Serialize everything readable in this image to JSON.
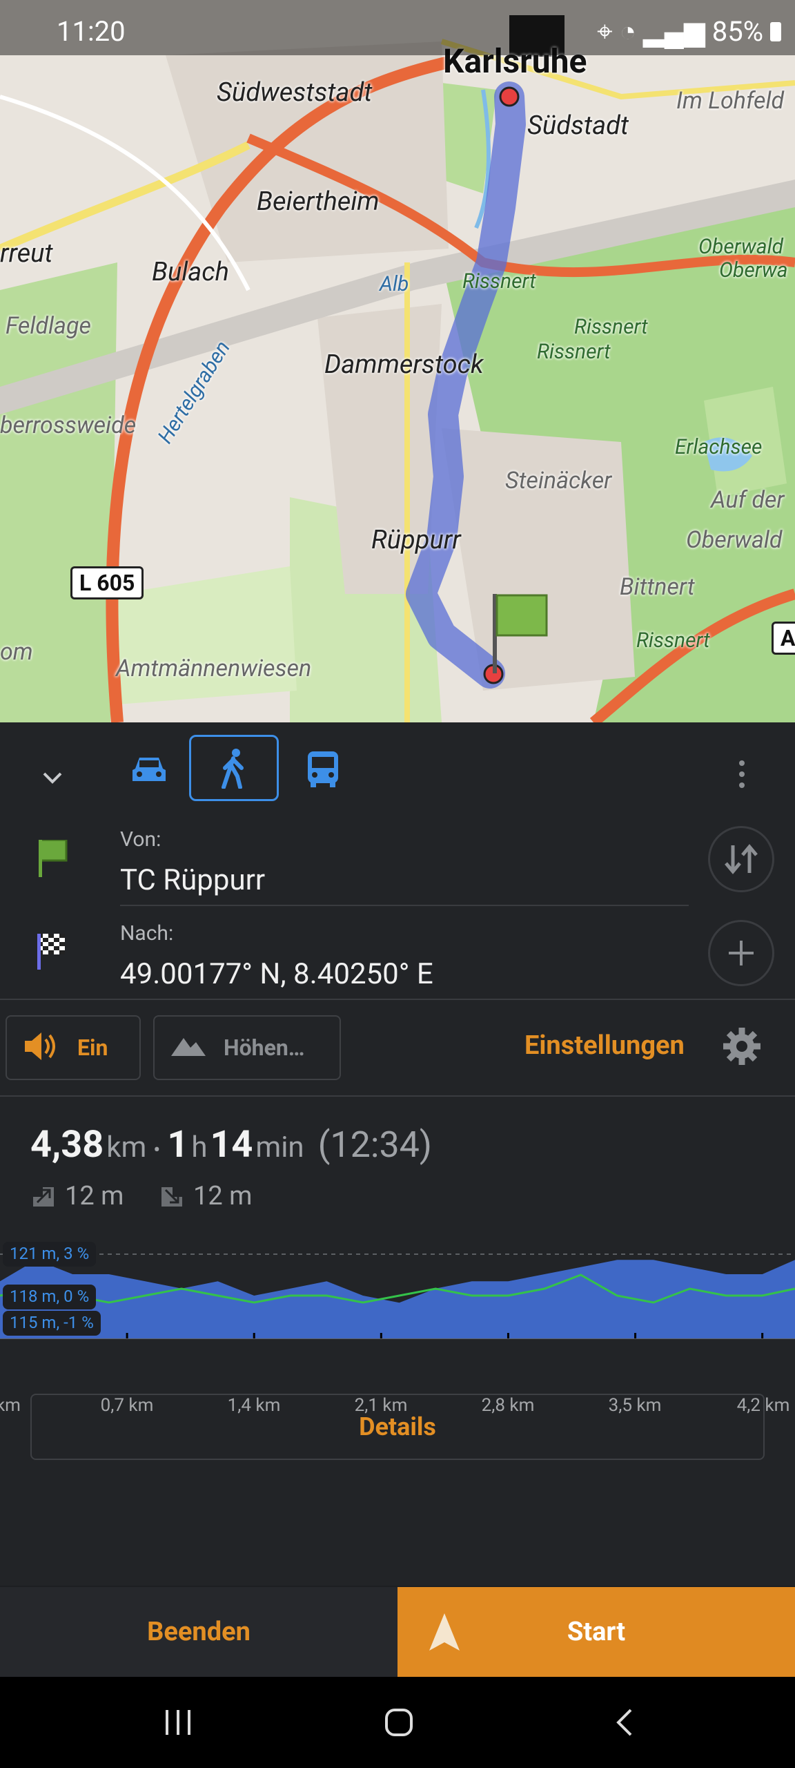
{
  "status": {
    "time": "11:20",
    "battery": "85%"
  },
  "map": {
    "labels": {
      "karlsruhe": "Karlsruhe",
      "suedweststadt": "Südweststadt",
      "suedstadt": "Südstadt",
      "im_lohfeld": "Im Lohfeld",
      "beiertheim": "Beiertheim",
      "rreut": "rreut",
      "bulach": "Bulach",
      "oberwald": "Oberwald",
      "oberwa": "Oberwa",
      "alb": "Alb",
      "rissnert1": "Rissnert",
      "feldlage": "Feldlage",
      "rissnert2": "Rissnert",
      "rissnert3": "Rissnert",
      "dammerstock": "Dammerstock",
      "berrossweide": "berrossweide",
      "hertelgraben": "Hertelgraben",
      "erlachsee": "Erlachsee",
      "steinaecker": "Steinäcker",
      "auf_der": "Auf der",
      "oberwald2": "Oberwald",
      "rueppurr": "Rüppurr",
      "bittnert": "Bittnert",
      "rissnert4": "Rissnert",
      "om": "om",
      "amtmaennenwiesen": "Amtmännenwiesen",
      "a_shield": "A"
    },
    "road_shield": "L 605"
  },
  "route": {
    "from_label": "Von:",
    "from_value": "TC Rüppurr",
    "to_label": "Nach:",
    "to_value": "49.00177° N, 8.40250° E"
  },
  "options": {
    "sound_label": "Ein",
    "elevation_label": "Höhen…",
    "settings_label": "Einstellungen"
  },
  "summary": {
    "distance": "4,38",
    "distance_unit": "km",
    "separator": "•",
    "hours": "1",
    "hours_unit": "h",
    "minutes": "14",
    "minutes_unit": "min",
    "arrival": "(12:34)",
    "ascent": "12 m",
    "descent": "12 m"
  },
  "elevation_chart": {
    "badge_top": "121 m, 3 %",
    "badge_mid": "118 m, 0 %",
    "badge_bot": "115 m, -1 %",
    "ticks": [
      "km",
      "0,7 km",
      "1,4 km",
      "2,1 km",
      "2,8 km",
      "3,5 km",
      "4,2 km"
    ]
  },
  "chart_data": {
    "type": "area",
    "xlabel": "",
    "ylabel": "",
    "x_ticks": [
      "km",
      "0,7 km",
      "1,4 km",
      "2,1 km",
      "2,8 km",
      "3,5 km",
      "4,2 km"
    ],
    "series": [
      {
        "color": "#3f68c6",
        "x": [
          0,
          0.2,
          0.4,
          0.6,
          0.8,
          1.0,
          1.2,
          1.4,
          1.6,
          1.8,
          2.0,
          2.2,
          2.4,
          2.6,
          2.8,
          3.0,
          3.2,
          3.4,
          3.6,
          3.8,
          4.0,
          4.2,
          4.38
        ],
        "values": [
          118,
          121,
          119,
          119,
          118,
          117,
          118,
          116,
          117,
          118,
          116,
          115,
          117,
          118,
          118,
          119,
          120,
          121,
          121,
          120,
          119,
          119,
          121
        ]
      },
      {
        "color": "#34c24a",
        "x": [
          0,
          0.2,
          0.4,
          0.6,
          0.8,
          1.0,
          1.2,
          1.4,
          1.6,
          1.8,
          2.0,
          2.2,
          2.4,
          2.6,
          2.8,
          3.0,
          3.2,
          3.4,
          3.6,
          3.8,
          4.0,
          4.2,
          4.38
        ],
        "values": [
          0,
          1,
          0,
          -1,
          0,
          1,
          0,
          -1,
          0,
          0,
          -1,
          0,
          1,
          0,
          0,
          1,
          3,
          0,
          -1,
          1,
          0,
          0,
          1
        ]
      }
    ]
  },
  "details_label": "Details",
  "actions": {
    "end_label": "Beenden",
    "start_label": "Start"
  }
}
